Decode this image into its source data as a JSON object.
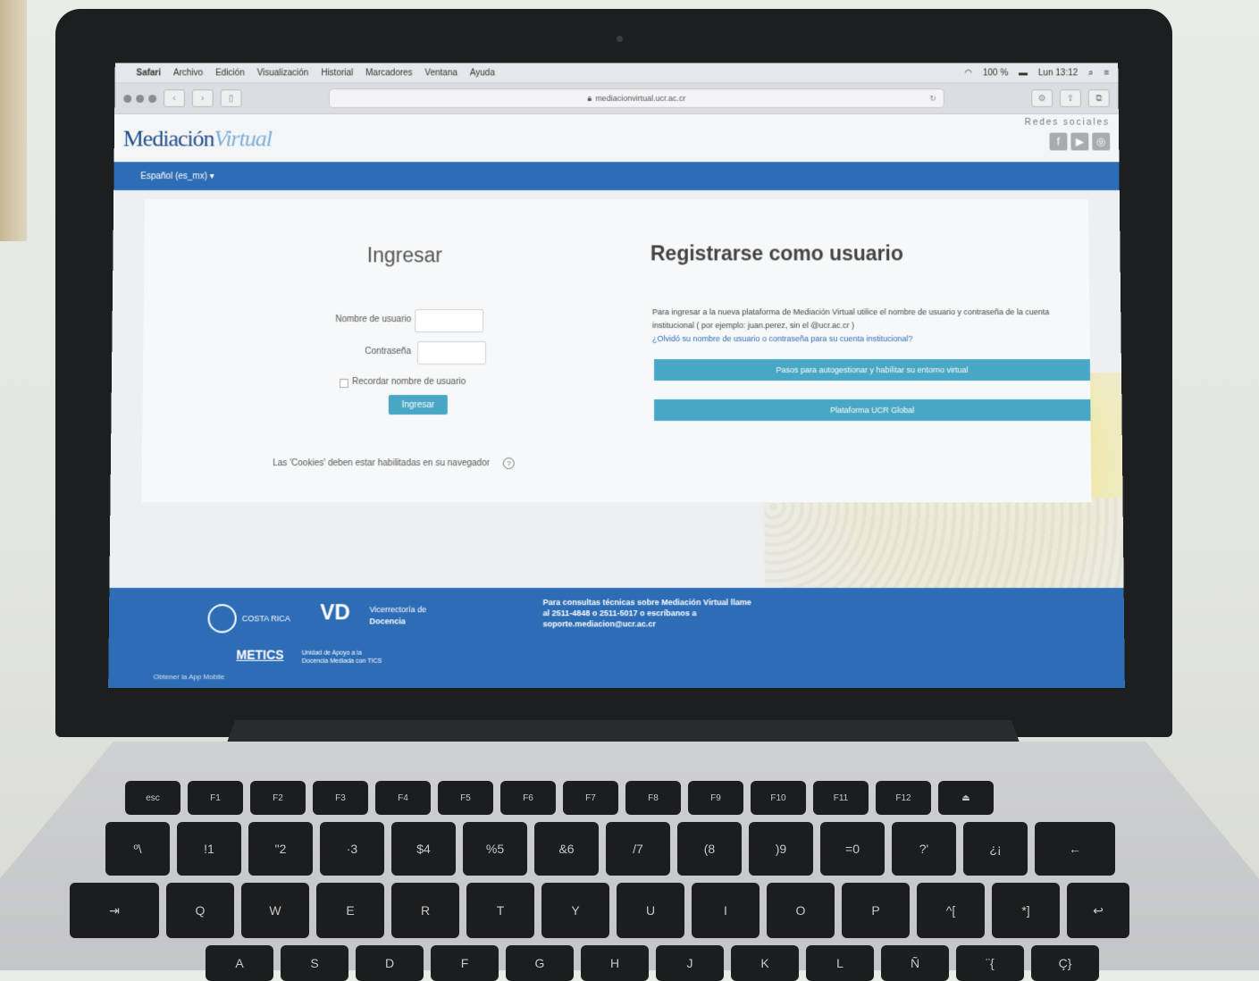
{
  "macos_menubar": {
    "items": [
      "Safari",
      "Archivo",
      "Edición",
      "Visualización",
      "Historial",
      "Marcadores",
      "Ventana",
      "Ayuda"
    ],
    "battery": "100 %",
    "clock": "Lun 13:12"
  },
  "browser": {
    "url": "mediacionvirtual.ucr.ac.cr"
  },
  "site_header": {
    "logo_part1": "Mediación",
    "logo_part2": "Virtual",
    "social_label": "Redes sociales"
  },
  "language_selector": "Español (es_mx) ▾",
  "login": {
    "title": "Ingresar",
    "username_label": "Nombre de usuario",
    "password_label": "Contraseña",
    "remember_label": "Recordar nombre de usuario",
    "submit_label": "Ingresar",
    "cookies_notice": "Las 'Cookies' deben estar habilitadas en su navegador"
  },
  "register": {
    "title": "Registrarse como usuario",
    "text": "Para ingresar a la nueva plataforma de Mediación Virtual utilice el nombre de usuario y contraseña de la cuenta institucional ( por ejemplo: juan.perez, sin el @ucr.ac.cr )",
    "forgot_link": "¿Olvidó su nombre de usuario o contraseña para su cuenta institucional?",
    "button1": "Pasos para autogestionar y habilitar su entorno virtual",
    "button2": "Plataforma UCR Global"
  },
  "footer": {
    "ucr": "COSTA RICA",
    "vd": "VD",
    "vd_text_line1": "Vicerrectoría de",
    "vd_text_line2": "Docencia",
    "metics": "METICS",
    "metics_sub_line1": "Unidad de Apoyo a la",
    "metics_sub_line2": "Docencia Mediada con TICS",
    "consult": "Para consultas técnicas sobre Mediación Virtual llame al 2511-4848 o 2511-5017 o escríbanos a soporte.mediacion@ucr.ac.cr",
    "app_link": "Obtener la App Mobile"
  },
  "keyboard": {
    "row1": [
      "esc",
      "F1",
      "F2",
      "F3",
      "F4",
      "F5",
      "F6",
      "F7",
      "F8",
      "F9",
      "F10",
      "F11",
      "F12",
      "⏏"
    ],
    "row2": [
      "º\\",
      "!1",
      "\"2",
      "·3",
      "$4",
      "%5",
      "&6",
      "/7",
      "(8",
      ")9",
      "=0",
      "?'",
      "¿¡",
      "←"
    ],
    "row3": [
      "⇥",
      "Q",
      "W",
      "E",
      "R",
      "T",
      "Y",
      "U",
      "I",
      "O",
      "P",
      "^[",
      "*]",
      "↩"
    ],
    "row4": [
      "A",
      "S",
      "D",
      "F",
      "G",
      "H",
      "J",
      "K",
      "L",
      "Ñ",
      "¨{",
      "Ç}"
    ]
  }
}
